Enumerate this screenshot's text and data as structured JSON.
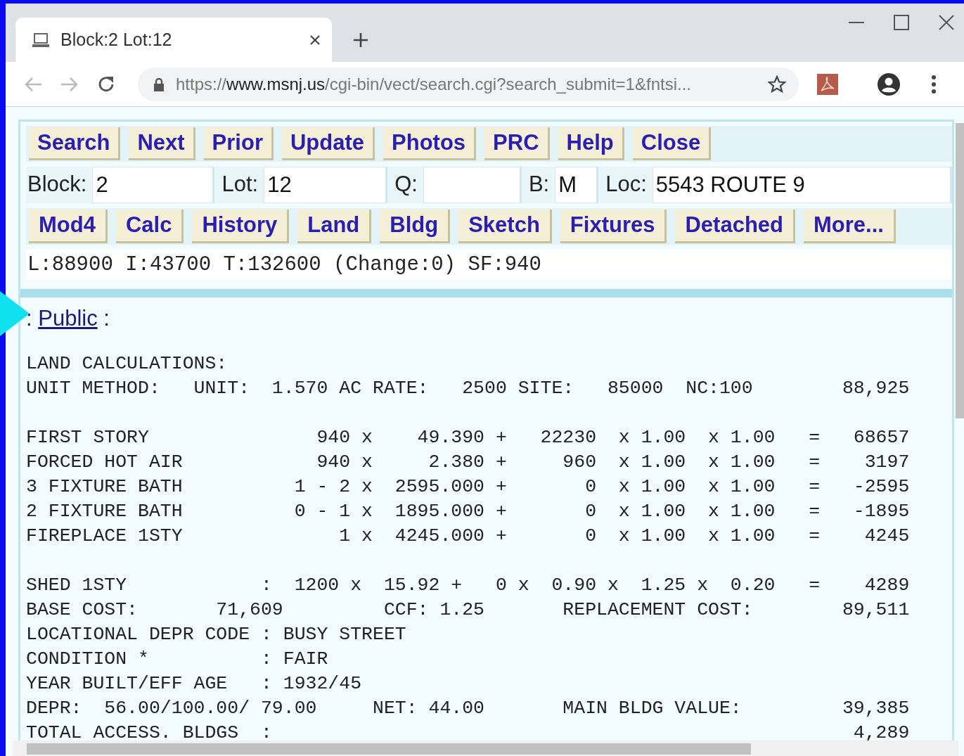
{
  "browser": {
    "tab": {
      "title": "Block:2 Lot:12"
    },
    "url": {
      "scheme": "https://",
      "host": "www.msnj.us",
      "path": "/cgi-bin/vect/search.cgi?search_submit=1&fntsi..."
    }
  },
  "toolbar_1": [
    "Search",
    "Next",
    "Prior",
    "Update",
    "Photos",
    "PRC",
    "Help",
    "Close"
  ],
  "fields": [
    {
      "label": "Block:",
      "value": "2"
    },
    {
      "label": "Lot:",
      "value": "12"
    },
    {
      "label": "Q:"
    },
    {
      "label": "B:",
      "value": "M"
    },
    {
      "label": "Loc:",
      "value": "5543 ROUTE 9"
    }
  ],
  "toolbar_2": [
    "Mod4",
    "Calc",
    "History",
    "Land",
    "Bldg",
    "Sketch",
    "Fixtures",
    "Detached",
    "More..."
  ],
  "summary": "L:88900 I:43700 T:132600 (Change:0) SF:940",
  "section": {
    "prefix": ":",
    "link": "Public",
    "suffix": ":"
  },
  "report": [
    [
      "LAND CALCULATIONS:",
      "UNIT METHOD:   UNIT:  1.570 AC RATE:   2500 SITE:   85000  NC:100        88,925"
    ],
    [
      "FIRST STORY               940 x    49.390 +   22230  x 1.00  x 1.00   =   68657",
      "FORCED HOT AIR            940 x     2.380 +     960  x 1.00  x 1.00   =    3197",
      "3 FIXTURE BATH          1 - 2 x  2595.000 +       0  x 1.00  x 1.00   =   -2595",
      "2 FIXTURE BATH          0 - 1 x  1895.000 +       0  x 1.00  x 1.00   =   -1895",
      "FIREPLACE 1STY              1 x  4245.000 +       0  x 1.00  x 1.00   =    4245"
    ],
    [
      "SHED 1STY            :  1200 x  15.92 +   0 x  0.90 x  1.25 x  0.20   =    4289",
      "BASE COST:       71,609         CCF: 1.25       REPLACEMENT COST:        89,511",
      "LOCATIONAL DEPR CODE : BUSY STREET",
      "CONDITION *          : FAIR",
      "YEAR BUILT/EFF AGE   : 1932/45",
      "DEPR:  56.00/100.00/ 79.00     NET: 44.00       MAIN BLDG VALUE:         39,385",
      "TOTAL ACCESS. BLDGS  :                                                    4,289"
    ]
  ]
}
